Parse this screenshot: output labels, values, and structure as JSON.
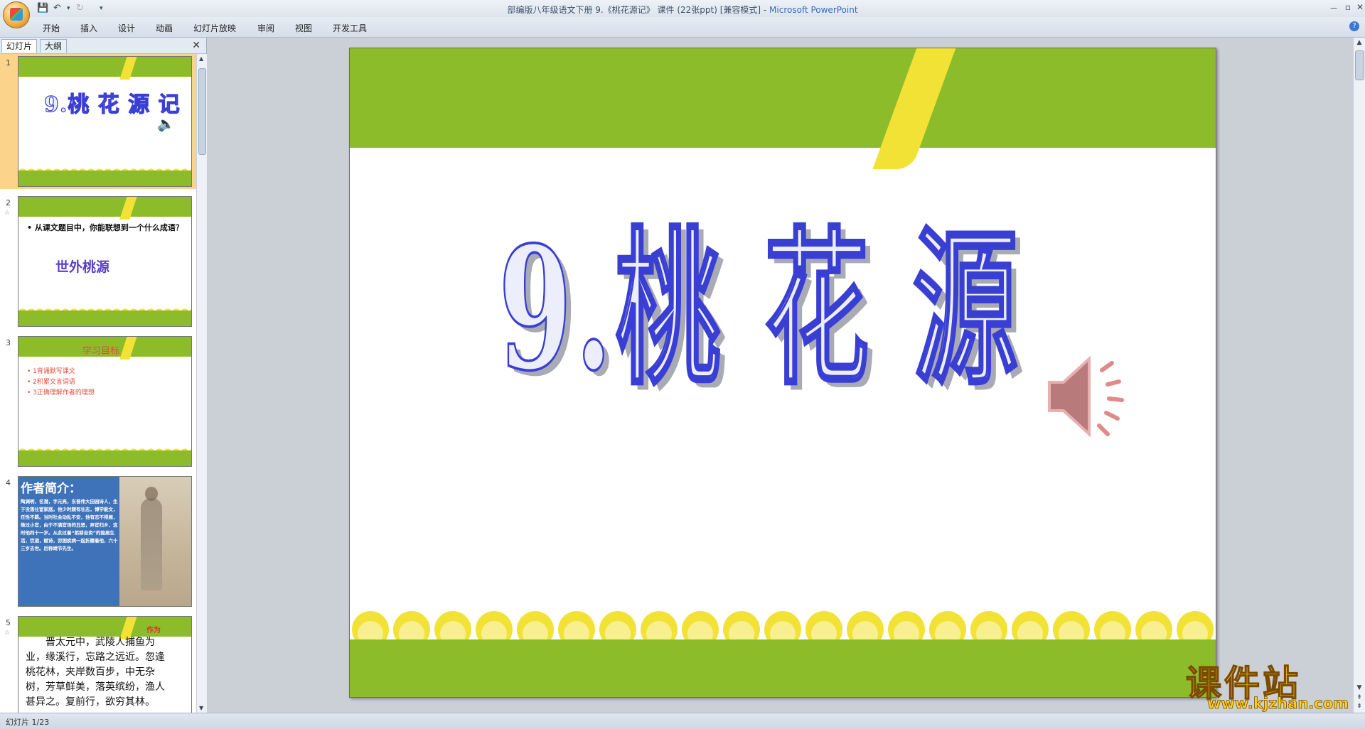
{
  "window": {
    "title": "部编版八年级语文下册 9.《桃花源记》 课件 (22张ppt) [兼容模式] - ",
    "app_name": "Microsoft PowerPoint",
    "controls": {
      "minimize": "－",
      "restore": "▫",
      "close": "✕"
    }
  },
  "ribbon": {
    "tabs": [
      "开始",
      "插入",
      "设计",
      "动画",
      "幻灯片放映",
      "审阅",
      "视图",
      "开发工具"
    ]
  },
  "left_pane": {
    "tabs": {
      "slides": "幻灯片",
      "outline": "大纲"
    },
    "close": "✕",
    "thumbnails": [
      {
        "num": "1",
        "selected": true,
        "title": "9.桃 花 源 记"
      },
      {
        "num": "2",
        "star": "☆",
        "bullet": "• 从课文题目中，你能联想到一个什么成语？",
        "answer": "世外桃源"
      },
      {
        "num": "3",
        "heading": "学习目标",
        "items": [
          "• 1背诵默写课文",
          "• 2积累文言词语",
          "• 3正确理解作者的理想"
        ]
      },
      {
        "num": "4",
        "heading": "作者简介：",
        "body": "陶渊明，名潜，字元亮，东晋伟大田园诗人，生于没落仕宦家庭。他少时颇有壮志，博学能文，任性不羁。当时社会动乱不安，他有志不得展，做过小官，由于不满官场的丑恶，弃官归乡，这时他四十一岁。从此过着“躬耕自资”的隐居生活，饮酒，赋诗，穷困疾病一起折磨着他，六十三岁去世。后称靖节先生。"
      },
      {
        "num": "5",
        "star": "☆",
        "lines": [
          "晋太元中，武陵人捕鱼为",
          "业，缘溪行，忘路之远近。忽逢",
          "桃花林，夹岸数百步，中无杂",
          "树，芳草鲜美，落英缤纷，渔人",
          "甚异之。复前行，欲穷其林。"
        ],
        "note": "作为"
      }
    ]
  },
  "slide": {
    "title": "9.桃 花 源 记",
    "colors": {
      "band": "#8cbc2a",
      "stripe": "#f3e236",
      "title_stroke": "#3a3fd4",
      "title_fill": "#eceefb",
      "title_shadow": "#a8aab4"
    }
  },
  "status": {
    "slide_indicator": "幻灯片 1/23"
  },
  "watermark": {
    "text": "课件站",
    "url": "www.kjzhan.com"
  }
}
